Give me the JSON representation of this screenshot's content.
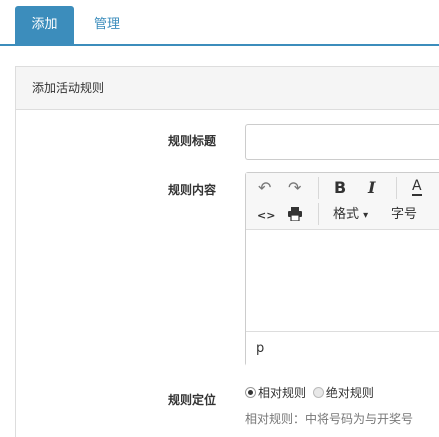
{
  "tabs": [
    {
      "label": "添加",
      "active": true
    },
    {
      "label": "管理",
      "active": false
    }
  ],
  "panel": {
    "title": "添加活动规则"
  },
  "form": {
    "title_label": "规则标题",
    "title_value": "",
    "content_label": "规则内容",
    "editor": {
      "toolbar": {
        "undo_icon": "↶",
        "redo_icon": "↷",
        "bold": "B",
        "italic": "I",
        "font_color": "A",
        "source_icon": "<>",
        "print_icon": "print-icon",
        "format_label": "格式",
        "format_caret": "▾",
        "font_size_label": "字号"
      },
      "status_path": "p"
    },
    "position_label": "规则定位",
    "position_options": [
      {
        "label": "相对规则",
        "checked": true
      },
      {
        "label": "绝对规则",
        "checked": false
      }
    ],
    "position_help": "相对规则：中将号码为与开奖号"
  },
  "colors": {
    "accent": "#3c8dbc",
    "panel_head_bg": "#f5f5f5",
    "border": "#dddddd"
  }
}
